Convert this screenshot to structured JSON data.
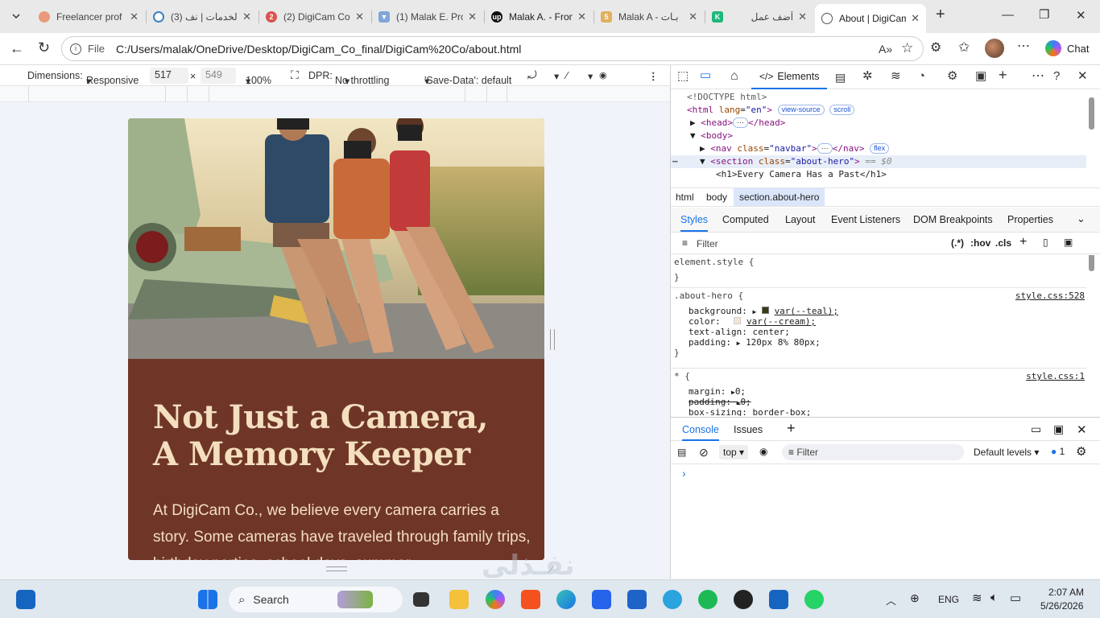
{
  "tabs": [
    {
      "title": "Freelancer prof",
      "favicon_color": "#e89a7a"
    },
    {
      "title": "(3) الخدمات | نف",
      "favicon_color": "#3b82c4"
    },
    {
      "title": "(2) DigiCam Co",
      "favicon_color": "#d9534f"
    },
    {
      "title": "(1) Malak E. Pro",
      "favicon_color": "#7fa7d8"
    },
    {
      "title": "Malak A. - Front",
      "favicon_color": "#111111"
    },
    {
      "title": "Malak A - بـات",
      "favicon_color": "#e0b060"
    },
    {
      "title": "",
      "favicon_color": "#1db87a"
    },
    {
      "title": "أضف عمل",
      "favicon_color": ""
    },
    {
      "title": "About | DigiCam",
      "favicon_color": "#555555"
    }
  ],
  "address": {
    "scheme": "File",
    "url": "C:/Users/malak/OneDrive/Desktop/DigiCam_Co_final/DigiCam%20Co/about.html",
    "chat_label": "Chat"
  },
  "device_toolbar": {
    "dimensions_label": "Dimensions:",
    "mode": "Responsive",
    "width": "517",
    "times": "×",
    "height": "549",
    "zoom": "100%",
    "dpr_label": "DPR:",
    "throttling": "No throttling",
    "save_data": "'Save-Data': default"
  },
  "page": {
    "title_line1": "Not Just a Camera,",
    "title_line2": "A Memory Keeper",
    "body": "At DigiCam Co., we believe every camera carries a story. Some cameras have traveled through family trips, birthday parties, school days, summer"
  },
  "devtools": {
    "tabs": [
      "Elements"
    ],
    "dom": {
      "doctype": "<!DOCTYPE html>",
      "html_open": "<html",
      "html_attr": "lang",
      "html_val": "\"en\"",
      "pill_viewsource": "view-source",
      "pill_scroll": "scroll",
      "head": "<head>",
      "head_close": "</head>",
      "body": "<body>",
      "nav_open": "<nav",
      "nav_attr": "class",
      "nav_val": "\"navbar\"",
      "nav_close": "</nav>",
      "pill_flex": "flex",
      "section_open": "<section",
      "section_attr": "class",
      "section_val": "\"about-hero\"",
      "section_suffix": "== $0",
      "h1_line": "<h1>Every Camera Has a Past</h1>"
    },
    "breadcrumb": [
      "html",
      "body",
      "section.about-hero"
    ],
    "style_tabs": [
      "Styles",
      "Computed",
      "Layout",
      "Event Listeners",
      "DOM Breakpoints",
      "Properties"
    ],
    "filter_placeholder": "Filter",
    "filter_tools": [
      ":hov",
      ".cls"
    ],
    "rules": {
      "element_style": "element.style {",
      "close": "}",
      "about_selector": ".about-hero {",
      "about_source": "style.css:528",
      "about_props": [
        {
          "name": "background:",
          "value": "var(--teal);"
        },
        {
          "name": "color:",
          "value": "var(--cream);"
        },
        {
          "name": "text-align:",
          "value": "center;"
        },
        {
          "name": "padding:",
          "value": "120px 8% 80px;"
        }
      ],
      "star_selector": "* {",
      "star_source": "style.css:1",
      "star_props": [
        {
          "name": "margin:",
          "value": "0;"
        },
        {
          "name": "padding:",
          "value": "0;"
        },
        {
          "name": "box-sizing:",
          "value": "border-box;"
        }
      ]
    },
    "console": {
      "tabs": [
        "Console",
        "Issues"
      ],
      "context": "top",
      "filter": "Filter",
      "levels": "Default levels",
      "issue_count": "1",
      "prompt": "›"
    }
  },
  "taskbar": {
    "search_label": "Search",
    "language": "ENG",
    "time": "2:07 AM",
    "date": "5/26/2026"
  }
}
